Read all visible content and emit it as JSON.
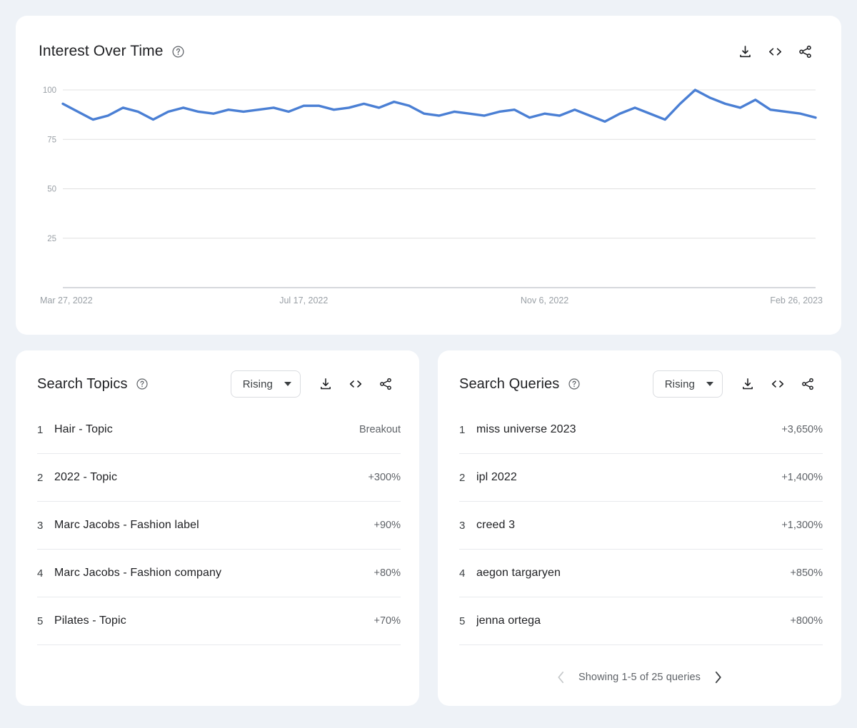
{
  "theme": {
    "page_background": "#eef2f7",
    "card_background": "#ffffff",
    "line_color": "#4a7fd4",
    "text_primary": "#202124",
    "text_secondary": "#5f6368",
    "grid_color": "#e0e0e0"
  },
  "interest": {
    "title": "Interest Over Time",
    "help_icon": "help-circle-icon",
    "tools": [
      {
        "name": "download-icon",
        "label": "Download"
      },
      {
        "name": "embed-code-icon",
        "label": "Embed"
      },
      {
        "name": "share-icon",
        "label": "Share"
      }
    ]
  },
  "chart_data": {
    "type": "line",
    "title": "Interest Over Time",
    "xlabel": "",
    "ylabel": "",
    "ylim": [
      0,
      100
    ],
    "yticks": [
      25,
      50,
      75,
      100
    ],
    "ytick_labels": [
      "25",
      "50",
      "75",
      "100"
    ],
    "grid": true,
    "legend": "none",
    "x_tick_labels": [
      "Mar 27, 2022",
      "Jul 17, 2022",
      "Nov 6, 2022",
      "Feb 26, 2023"
    ],
    "x_tick_positions": [
      0,
      16,
      32,
      48
    ],
    "series": [
      {
        "name": "Interest",
        "color": "#4a7fd4",
        "values": [
          93,
          89,
          85,
          87,
          91,
          89,
          85,
          89,
          91,
          89,
          88,
          90,
          89,
          90,
          91,
          89,
          92,
          92,
          90,
          91,
          93,
          91,
          94,
          92,
          88,
          87,
          89,
          88,
          87,
          89,
          90,
          86,
          88,
          87,
          90,
          87,
          84,
          88,
          91,
          88,
          85,
          93,
          100,
          96,
          93,
          91,
          95,
          90,
          89,
          88,
          86
        ]
      }
    ]
  },
  "topics": {
    "title": "Search Topics",
    "help_icon": "help-circle-icon",
    "filter": {
      "label": "Rising",
      "icon": "chevron-down-icon"
    },
    "tools": [
      {
        "name": "download-icon",
        "label": "Download"
      },
      {
        "name": "embed-code-icon",
        "label": "Embed"
      },
      {
        "name": "share-icon",
        "label": "Share"
      }
    ],
    "rows": [
      {
        "rank": "1",
        "label": "Hair - Topic",
        "value": "Breakout"
      },
      {
        "rank": "2",
        "label": "2022 - Topic",
        "value": "+300%"
      },
      {
        "rank": "3",
        "label": "Marc Jacobs - Fashion label",
        "value": "+90%"
      },
      {
        "rank": "4",
        "label": "Marc Jacobs - Fashion company",
        "value": "+80%"
      },
      {
        "rank": "5",
        "label": "Pilates - Topic",
        "value": "+70%"
      }
    ]
  },
  "queries": {
    "title": "Search Queries",
    "help_icon": "help-circle-icon",
    "filter": {
      "label": "Rising",
      "icon": "chevron-down-icon"
    },
    "tools": [
      {
        "name": "download-icon",
        "label": "Download"
      },
      {
        "name": "embed-code-icon",
        "label": "Embed"
      },
      {
        "name": "share-icon",
        "label": "Share"
      }
    ],
    "rows": [
      {
        "rank": "1",
        "label": "miss universe 2023",
        "value": "+3,650%"
      },
      {
        "rank": "2",
        "label": "ipl 2022",
        "value": "+1,400%"
      },
      {
        "rank": "3",
        "label": "creed 3",
        "value": "+1,300%"
      },
      {
        "rank": "4",
        "label": "aegon targaryen",
        "value": "+850%"
      },
      {
        "rank": "5",
        "label": "jenna ortega",
        "value": "+800%"
      }
    ],
    "pagination": {
      "prev_icon": "chevron-left-icon",
      "next_icon": "chevron-right-icon",
      "text": "Showing 1-5 of 25 queries"
    }
  }
}
